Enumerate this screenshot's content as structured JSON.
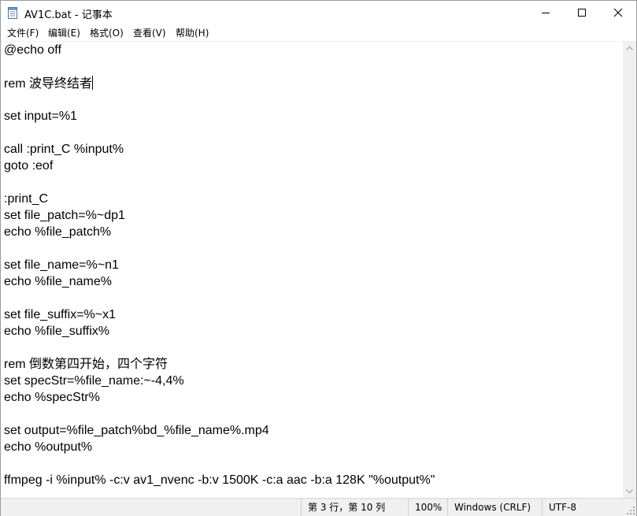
{
  "window": {
    "title": "AV1C.bat - 记事本"
  },
  "menu": [
    "文件(F)",
    "编辑(E)",
    "格式(O)",
    "查看(V)",
    "帮助(H)"
  ],
  "lines": [
    "@echo off",
    "",
    "rem 波导终结者",
    "",
    "set input=%1",
    "",
    "call :print_C %input%",
    "goto :eof",
    "",
    ":print_C",
    "set file_patch=%~dp1",
    "echo %file_patch%",
    "",
    "set file_name=%~n1",
    "echo %file_name%",
    "",
    "set file_suffix=%~x1",
    "echo %file_suffix%",
    "",
    "rem 倒数第四开始，四个字符",
    "set specStr=%file_name:~-4,4%",
    "echo %specStr%",
    "",
    "set output=%file_patch%bd_%file_name%.mp4",
    "echo %output%",
    "",
    "ffmpeg -i %input% -c:v av1_nvenc -b:v 1500K -c:a aac -b:a 128K \"%output%\""
  ],
  "status": {
    "position": "第 3 行，第 10 列",
    "zoom": "100%",
    "line_ending": "Windows (CRLF)",
    "encoding": "UTF-8"
  }
}
